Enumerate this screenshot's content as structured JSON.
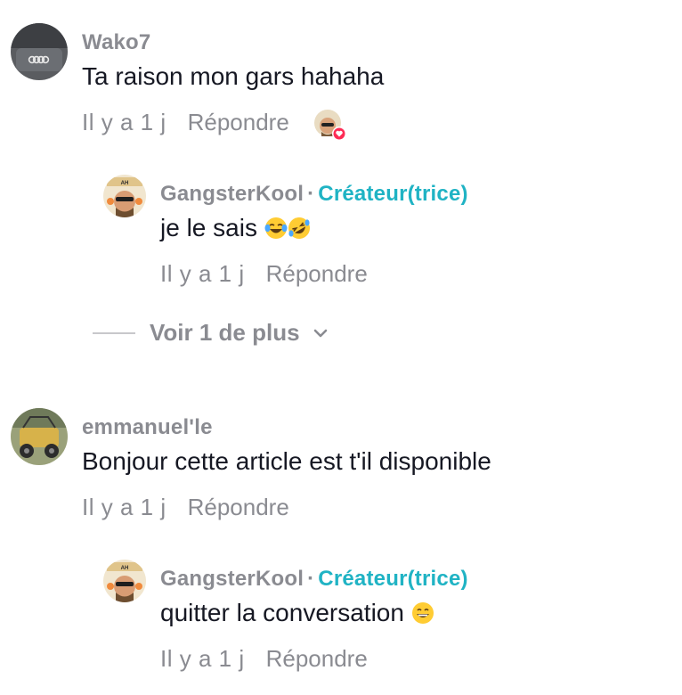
{
  "comments": [
    {
      "username": "Wako7",
      "text": "Ta raison mon gars hahaha",
      "time": "Il y a 1 j",
      "reply_label": "Répondre",
      "liked_by_creator": true,
      "replies": [
        {
          "username": "GangsterKool",
          "separator": "·",
          "role": "Créateur(trice)",
          "text": "je le sais",
          "emojis": [
            "face-with-tears-of-joy-icon",
            "rolling-on-floor-laughing-icon"
          ],
          "time": "Il y a 1 j",
          "reply_label": "Répondre"
        }
      ],
      "more_label": "Voir 1 de plus"
    },
    {
      "username": "emmanuel'le",
      "text": "Bonjour cette article est t'il disponible",
      "time": "Il y a 1 j",
      "reply_label": "Répondre",
      "replies": [
        {
          "username": "GangsterKool",
          "separator": "·",
          "role": "Créateur(trice)",
          "text": "quitter la conversation",
          "emojis": [
            "grinning-face-with-big-eyes-icon"
          ],
          "time": "Il y a 1 j",
          "reply_label": "Répondre"
        }
      ]
    }
  ],
  "colors": {
    "username": "#8a8b91",
    "creator_role": "#20b3c4",
    "text": "#161823",
    "meta": "#8a8b91",
    "heart_badge": "#fe2c55"
  }
}
